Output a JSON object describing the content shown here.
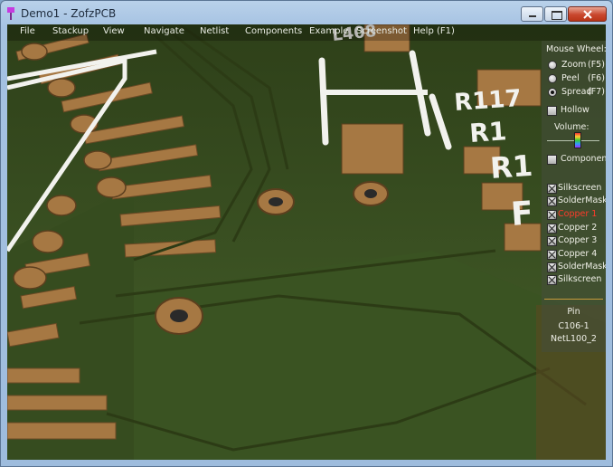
{
  "window": {
    "title": "Demo1 - ZofzPCB"
  },
  "menu": [
    "File",
    "Stackup",
    "View",
    "Navigate",
    "Netlist",
    "Components",
    "Example",
    "Screenshot",
    "Help (F1)"
  ],
  "panel": {
    "mouse_wheel_label": "Mouse Wheel:",
    "wheel_options": [
      {
        "label": "Zoom",
        "key": "(F5)",
        "selected": false
      },
      {
        "label": "Peel",
        "key": "(F6)",
        "selected": false
      },
      {
        "label": "Spread",
        "key": "(F7)",
        "selected": true
      }
    ],
    "hollow_label": "Hollow",
    "volume_label": "Volume:",
    "components_label": "Components",
    "layers": [
      {
        "label": "Silkscreen",
        "checked": true,
        "color": "#f0f0e8"
      },
      {
        "label": "SolderMask",
        "checked": true,
        "color": "#f0f0e8"
      },
      {
        "label": "Copper 1",
        "checked": true,
        "color": "#ff3b2a"
      },
      {
        "label": "Copper 2",
        "checked": true,
        "color": "#f0f0e8"
      },
      {
        "label": "Copper 3",
        "checked": true,
        "color": "#f0f0e8"
      },
      {
        "label": "Copper 4",
        "checked": true,
        "color": "#f0f0e8"
      },
      {
        "label": "SolderMask",
        "checked": true,
        "color": "#f0f0e8"
      },
      {
        "label": "Silkscreen",
        "checked": true,
        "color": "#f0f0e8"
      }
    ],
    "selection": {
      "type": "Pin",
      "component": "C106-1",
      "net": "NetL100_2"
    }
  },
  "board": {
    "silk_labels": [
      "L408",
      "R117",
      "R1",
      "R1",
      "F"
    ],
    "colors": {
      "soldermask": "#3f5a26",
      "copper": "#a87a42",
      "silk": "#f2f2ee"
    }
  }
}
